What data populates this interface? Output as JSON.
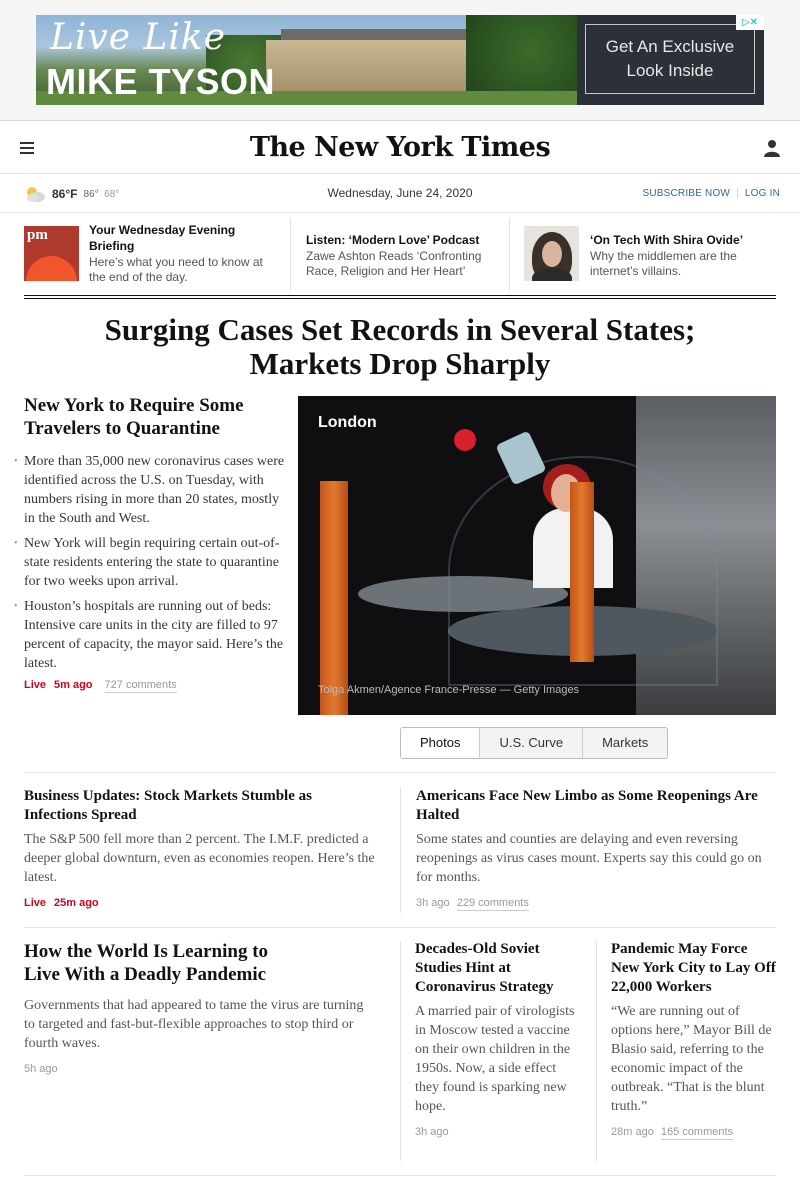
{
  "ad": {
    "script_text": "Live Like",
    "name_text": "MIKE TYSON",
    "cta_line1": "Get An Exclusive",
    "cta_line2": "Look Inside",
    "adchoices_label": "▷✕"
  },
  "masthead": {
    "logo": "The New York Times"
  },
  "datebar": {
    "temp_now": "86°F",
    "temp_high": "86°",
    "temp_low": "68°",
    "date": "Wednesday, June 24, 2020",
    "subscribe": "SUBSCRIBE NOW",
    "login": "LOG IN"
  },
  "briefings": [
    {
      "title": "Your Wednesday Evening Briefing",
      "desc": "Here’s what you need to know at the end of the day.",
      "thumb_label": "pm"
    },
    {
      "title": "Listen: ‘Modern Love’ Podcast",
      "desc": "Zawe Ashton Reads ‘Confronting Race, Religion and Her Heart’"
    },
    {
      "title": "‘On Tech With Shira Ovide’",
      "desc": "Why the middlemen are the internet’s villains."
    }
  ],
  "main_headline": "Surging Cases Set Records in Several States; Markets Drop Sharply",
  "lead": {
    "headline": "New York to Require Some Travelers to Quarantine",
    "bullets": [
      "More than 35,000 new coronavirus cases were identified across the U.S. on Tuesday, with numbers rising in more than 20 states, mostly in the South and West.",
      "New York will begin requiring certain out-of-state residents entering the state to quarantine for two weeks upon arrival.",
      "Houston’s hospitals are running out of beds:  Intensive care units in the city are filled to 97 percent of capacity, the mayor said. Here’s the latest."
    ],
    "live": "Live",
    "time": "5m ago",
    "comments": "727 comments"
  },
  "photo": {
    "location": "London",
    "credit": "Tolga Akmen/Agence France-Presse — Getty Images"
  },
  "tabs": [
    "Photos",
    "U.S. Curve",
    "Markets"
  ],
  "stories_row1": [
    {
      "headline": "Business Updates: Stock Markets Stumble as Infections Spread",
      "summary": "The S&P 500 fell more than 2 percent. The I.M.F. predicted a deeper global downturn, even as economies reopen. Here’s the latest.",
      "live": "Live",
      "time": "25m ago"
    },
    {
      "headline": "Americans Face New Limbo as Some Reopenings Are Halted",
      "summary": "Some states and counties are delaying and even reversing reopenings as virus cases mount. Experts say this could go on for months.",
      "time": "3h ago",
      "comments": "229 comments"
    }
  ],
  "stories_row2": [
    {
      "headline": "How the World Is Learning to Live With a Deadly Pandemic",
      "summary": "Governments that had appeared to tame the virus are turning to targeted and fast-but-flexible approaches to stop third or fourth waves.",
      "time": "5h ago"
    },
    {
      "headline": "Decades-Old Soviet Studies Hint at Coronavirus Strategy",
      "summary": "A married pair of virologists in Moscow tested a vaccine on their own children in the 1950s. Now, a side effect they found is sparking new hope.",
      "time": "3h ago"
    },
    {
      "headline": "Pandemic May Force New York City to Lay Off 22,000 Workers",
      "summary": "“We are running out of options here,” Mayor Bill de Blasio said, referring to the economic impact of the outbreak. “That is the blunt truth.”",
      "time": "28m ago",
      "comments": "165 comments"
    }
  ]
}
